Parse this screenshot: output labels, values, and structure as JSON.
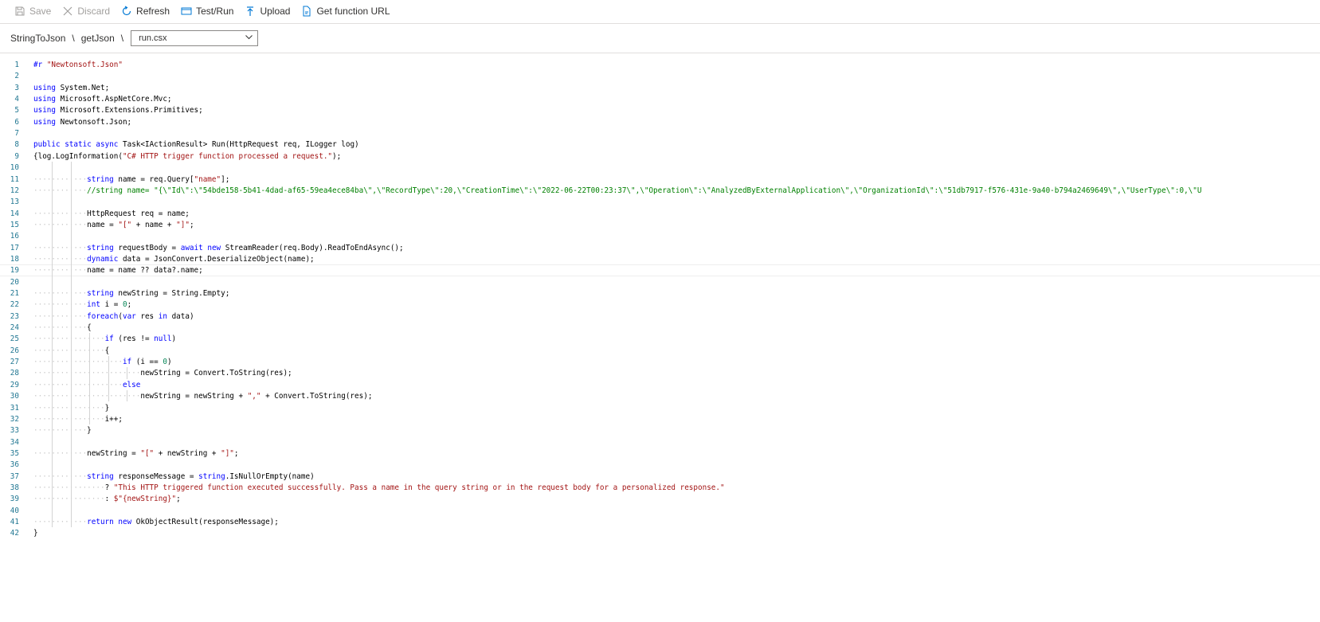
{
  "toolbar": {
    "save": "Save",
    "discard": "Discard",
    "refresh": "Refresh",
    "test_run": "Test/Run",
    "upload": "Upload",
    "get_url": "Get function URL"
  },
  "breadcrumb": {
    "app": "StringToJson",
    "function": "getJson",
    "separator": "\\",
    "file_selected": "run.csx"
  },
  "editor": {
    "current_line": 19,
    "lines": [
      {
        "n": 1,
        "ind": 0,
        "t": [
          [
            "pp",
            "#r"
          ],
          [
            "txt",
            " "
          ],
          [
            "str",
            "\"Newtonsoft.Json\""
          ]
        ]
      },
      {
        "n": 2,
        "ind": 0,
        "t": []
      },
      {
        "n": 3,
        "ind": 0,
        "t": [
          [
            "kw",
            "using"
          ],
          [
            "txt",
            " System.Net;"
          ]
        ]
      },
      {
        "n": 4,
        "ind": 0,
        "t": [
          [
            "kw",
            "using"
          ],
          [
            "txt",
            " Microsoft.AspNetCore.Mvc;"
          ]
        ]
      },
      {
        "n": 5,
        "ind": 0,
        "t": [
          [
            "kw",
            "using"
          ],
          [
            "txt",
            " Microsoft.Extensions.Primitives;"
          ]
        ]
      },
      {
        "n": 6,
        "ind": 0,
        "t": [
          [
            "kw",
            "using"
          ],
          [
            "txt",
            " Newtonsoft.Json;"
          ]
        ]
      },
      {
        "n": 7,
        "ind": 0,
        "t": []
      },
      {
        "n": 8,
        "ind": 0,
        "t": [
          [
            "kw",
            "public"
          ],
          [
            "txt",
            " "
          ],
          [
            "kw",
            "static"
          ],
          [
            "txt",
            " "
          ],
          [
            "kw",
            "async"
          ],
          [
            "txt",
            " Task<IActionResult> Run(HttpRequest req, ILogger log)"
          ]
        ]
      },
      {
        "n": 9,
        "ind": 0,
        "t": [
          [
            "txt",
            "{log.LogInformation("
          ],
          [
            "str",
            "\"C# HTTP trigger function processed a request.\""
          ],
          [
            "txt",
            ");"
          ]
        ]
      },
      {
        "n": 10,
        "ind": 0,
        "t": []
      },
      {
        "n": 11,
        "ind": 12,
        "t": [
          [
            "kw",
            "string"
          ],
          [
            "txt",
            " name = req.Query["
          ],
          [
            "str",
            "\"name\""
          ],
          [
            "txt",
            "];"
          ]
        ]
      },
      {
        "n": 12,
        "ind": 12,
        "t": [
          [
            "cm",
            "//string name= \"{\\\"Id\\\":\\\"54bde158-5b41-4dad-af65-59ea4ece84ba\\\",\\\"RecordType\\\":20,\\\"CreationTime\\\":\\\"2022-06-22T00:23:37\\\",\\\"Operation\\\":\\\"AnalyzedByExternalApplication\\\",\\\"OrganizationId\\\":\\\"51db7917-f576-431e-9a40-b794a2469649\\\",\\\"UserType\\\":0,\\\"U"
          ]
        ]
      },
      {
        "n": 13,
        "ind": 0,
        "t": []
      },
      {
        "n": 14,
        "ind": 12,
        "t": [
          [
            "txt",
            "HttpRequest req = name;"
          ]
        ]
      },
      {
        "n": 15,
        "ind": 12,
        "t": [
          [
            "txt",
            "name = "
          ],
          [
            "str",
            "\"[\""
          ],
          [
            "txt",
            " + name + "
          ],
          [
            "str",
            "\"]\""
          ],
          [
            "txt",
            ";"
          ]
        ]
      },
      {
        "n": 16,
        "ind": 0,
        "t": []
      },
      {
        "n": 17,
        "ind": 12,
        "t": [
          [
            "kw",
            "string"
          ],
          [
            "txt",
            " requestBody = "
          ],
          [
            "kw",
            "await"
          ],
          [
            "txt",
            " "
          ],
          [
            "kw",
            "new"
          ],
          [
            "txt",
            " StreamReader(req.Body).ReadToEndAsync();"
          ]
        ]
      },
      {
        "n": 18,
        "ind": 12,
        "t": [
          [
            "kw",
            "dynamic"
          ],
          [
            "txt",
            " data = JsonConvert.DeserializeObject(name);"
          ]
        ]
      },
      {
        "n": 19,
        "ind": 12,
        "t": [
          [
            "txt",
            "name = name ?? data?.name;"
          ]
        ]
      },
      {
        "n": 20,
        "ind": 0,
        "t": []
      },
      {
        "n": 21,
        "ind": 12,
        "t": [
          [
            "kw",
            "string"
          ],
          [
            "txt",
            " newString = String.Empty;"
          ]
        ]
      },
      {
        "n": 22,
        "ind": 12,
        "t": [
          [
            "kw",
            "int"
          ],
          [
            "txt",
            " i = "
          ],
          [
            "num",
            "0"
          ],
          [
            "txt",
            ";"
          ]
        ]
      },
      {
        "n": 23,
        "ind": 12,
        "t": [
          [
            "kw",
            "foreach"
          ],
          [
            "txt",
            "("
          ],
          [
            "kw",
            "var"
          ],
          [
            "txt",
            " res "
          ],
          [
            "kw",
            "in"
          ],
          [
            "txt",
            " data)"
          ]
        ]
      },
      {
        "n": 24,
        "ind": 12,
        "t": [
          [
            "txt",
            "{"
          ]
        ]
      },
      {
        "n": 25,
        "ind": 16,
        "t": [
          [
            "kw",
            "if"
          ],
          [
            "txt",
            " (res != "
          ],
          [
            "kw",
            "null"
          ],
          [
            "txt",
            ")"
          ]
        ]
      },
      {
        "n": 26,
        "ind": 16,
        "t": [
          [
            "txt",
            "{"
          ]
        ]
      },
      {
        "n": 27,
        "ind": 20,
        "t": [
          [
            "kw",
            "if"
          ],
          [
            "txt",
            " (i == "
          ],
          [
            "num",
            "0"
          ],
          [
            "txt",
            ")"
          ]
        ]
      },
      {
        "n": 28,
        "ind": 24,
        "t": [
          [
            "txt",
            "newString = Convert.ToString(res);"
          ]
        ]
      },
      {
        "n": 29,
        "ind": 20,
        "t": [
          [
            "kw",
            "else"
          ]
        ]
      },
      {
        "n": 30,
        "ind": 24,
        "t": [
          [
            "txt",
            "newString = newString + "
          ],
          [
            "str",
            "\",\""
          ],
          [
            "txt",
            " + Convert.ToString(res);"
          ]
        ]
      },
      {
        "n": 31,
        "ind": 16,
        "t": [
          [
            "txt",
            "}"
          ]
        ]
      },
      {
        "n": 32,
        "ind": 16,
        "t": [
          [
            "txt",
            "i++;"
          ]
        ]
      },
      {
        "n": 33,
        "ind": 12,
        "t": [
          [
            "txt",
            "}"
          ]
        ]
      },
      {
        "n": 34,
        "ind": 0,
        "t": []
      },
      {
        "n": 35,
        "ind": 12,
        "t": [
          [
            "txt",
            "newString = "
          ],
          [
            "str",
            "\"[\""
          ],
          [
            "txt",
            " + newString + "
          ],
          [
            "str",
            "\"]\""
          ],
          [
            "txt",
            ";"
          ]
        ]
      },
      {
        "n": 36,
        "ind": 0,
        "t": []
      },
      {
        "n": 37,
        "ind": 12,
        "t": [
          [
            "kw",
            "string"
          ],
          [
            "txt",
            " responseMessage = "
          ],
          [
            "kw",
            "string"
          ],
          [
            "txt",
            ".IsNullOrEmpty(name)"
          ]
        ]
      },
      {
        "n": 38,
        "ind": 16,
        "t": [
          [
            "txt",
            "? "
          ],
          [
            "str",
            "\"This HTTP triggered function executed successfully. Pass a name in the query string or in the request body for a personalized response.\""
          ]
        ]
      },
      {
        "n": 39,
        "ind": 16,
        "t": [
          [
            "txt",
            ": "
          ],
          [
            "str",
            "$\"{newString}\""
          ],
          [
            "txt",
            ";"
          ]
        ]
      },
      {
        "n": 40,
        "ind": 0,
        "t": []
      },
      {
        "n": 41,
        "ind": 12,
        "t": [
          [
            "kw",
            "return"
          ],
          [
            "txt",
            " "
          ],
          [
            "kw",
            "new"
          ],
          [
            "txt",
            " OkObjectResult(responseMessage);"
          ]
        ]
      },
      {
        "n": 42,
        "ind": 0,
        "t": [
          [
            "txt",
            "}"
          ]
        ]
      }
    ]
  }
}
